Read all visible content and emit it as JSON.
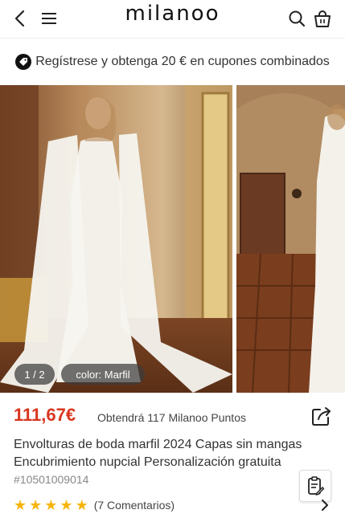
{
  "header": {
    "logo": "milanoo",
    "back_icon": "back-arrow-icon",
    "menu_icon": "hamburger-menu-icon",
    "search_icon": "search-icon",
    "cart_icon": "cart-icon"
  },
  "promo": {
    "icon": "tag-icon",
    "text": "Regístrese y obtenga 20 € en cupones combinados"
  },
  "gallery": {
    "counter": "1 / 2",
    "color_label": "color: Marfil"
  },
  "product": {
    "price": "111,67€",
    "points_text": "Obtendrá 117 Milanoo Puntos",
    "title": "Envolturas de boda marfil 2024 Capas sin mangas Encubrimiento nupcial Personalización gratuita",
    "sku": "#10501009014",
    "rating": 5,
    "reviews_text": "(7 Comentarios)"
  },
  "colors": {
    "price": "#d9361f",
    "star": "#f5b50b",
    "pill_bg": "#3c3c3c"
  }
}
